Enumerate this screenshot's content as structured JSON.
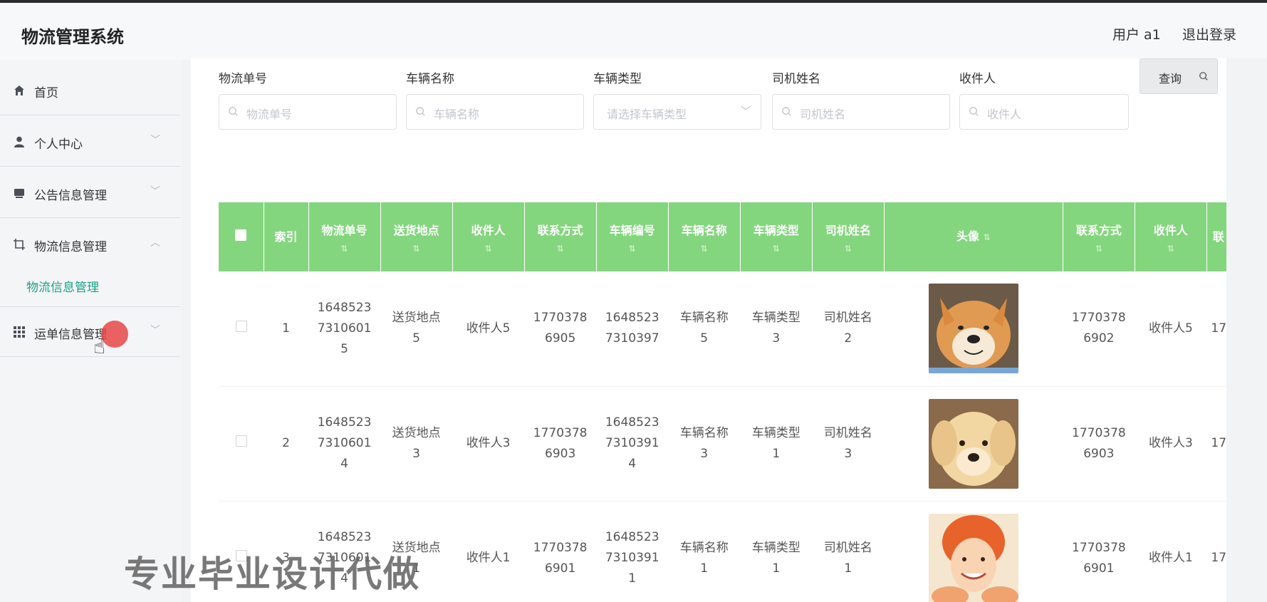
{
  "app": {
    "title": "物流管理系统",
    "user_label": "用户 a1",
    "logout_label": "退出登录"
  },
  "sidebar": {
    "items": [
      {
        "label": "首页",
        "icon": "home-icon",
        "expandable": false
      },
      {
        "label": "个人中心",
        "icon": "user-icon",
        "expandable": true
      },
      {
        "label": "公告信息管理",
        "icon": "notice-icon",
        "expandable": true
      },
      {
        "label": "物流信息管理",
        "icon": "crop-icon",
        "expandable": true,
        "expanded": true
      },
      {
        "label": "运单信息管理",
        "icon": "grid-icon",
        "expandable": true
      }
    ],
    "submenu_active": "物流信息管理",
    "active_color": "#19a387"
  },
  "filters": {
    "fields": [
      {
        "label": "物流单号",
        "placeholder": "物流单号",
        "type": "search"
      },
      {
        "label": "车辆名称",
        "placeholder": "车辆名称",
        "type": "search"
      },
      {
        "label": "车辆类型",
        "placeholder": "请选择车辆类型",
        "type": "select"
      },
      {
        "label": "司机姓名",
        "placeholder": "司机姓名",
        "type": "search"
      },
      {
        "label": "收件人",
        "placeholder": "收件人",
        "type": "search"
      }
    ],
    "query_label": "查询"
  },
  "table": {
    "header_color": "#84d67e",
    "columns": [
      "索引",
      "物流单号",
      "送货地点",
      "收件人",
      "联系方式",
      "车辆编号",
      "车辆名称",
      "车辆类型",
      "司机姓名",
      "头像",
      "联系方式",
      "收件人",
      "联"
    ],
    "rows": [
      {
        "index": "1",
        "order_no": [
          "1648523",
          "7310601",
          "5"
        ],
        "address": [
          "送货地点",
          "5"
        ],
        "recipient": "收件人5",
        "phone": [
          "1770378",
          "6905"
        ],
        "vehicle_no": [
          "1648523",
          "7310397"
        ],
        "vehicle_name": [
          "车辆名称",
          "5"
        ],
        "vehicle_type": [
          "车辆类型",
          "3"
        ],
        "driver": [
          "司机姓名",
          "2"
        ],
        "avatar": "shiba-dog",
        "phone2": [
          "1770378",
          "6902"
        ],
        "recipient2": "收件人5",
        "cut": "17"
      },
      {
        "index": "2",
        "order_no": [
          "1648523",
          "7310601",
          "4"
        ],
        "address": [
          "送货地点",
          "3"
        ],
        "recipient": "收件人3",
        "phone": [
          "1770378",
          "6903"
        ],
        "vehicle_no": [
          "1648523",
          "7310391",
          "4"
        ],
        "vehicle_name": [
          "车辆名称",
          "3"
        ],
        "vehicle_type": [
          "车辆类型",
          "1"
        ],
        "driver": [
          "司机姓名",
          "3"
        ],
        "avatar": "golden-puppy",
        "phone2": [
          "1770378",
          "6903"
        ],
        "recipient2": "收件人3",
        "cut": "17"
      },
      {
        "index": "3",
        "order_no": [
          "1648523",
          "7310601",
          "4"
        ],
        "address": [
          "送货地点",
          "1"
        ],
        "recipient": "收件人1",
        "phone": [
          "1770378",
          "6901"
        ],
        "vehicle_no": [
          "1648523",
          "7310391",
          "1"
        ],
        "vehicle_name": [
          "车辆名称",
          "1"
        ],
        "vehicle_type": [
          "车辆类型",
          "1"
        ],
        "driver": [
          "司机姓名",
          "1"
        ],
        "avatar": "smiling-woman",
        "phone2": [
          "1770378",
          "6901"
        ],
        "recipient2": "收件人1",
        "cut": "17"
      }
    ]
  },
  "watermark": "专业毕业设计代做"
}
